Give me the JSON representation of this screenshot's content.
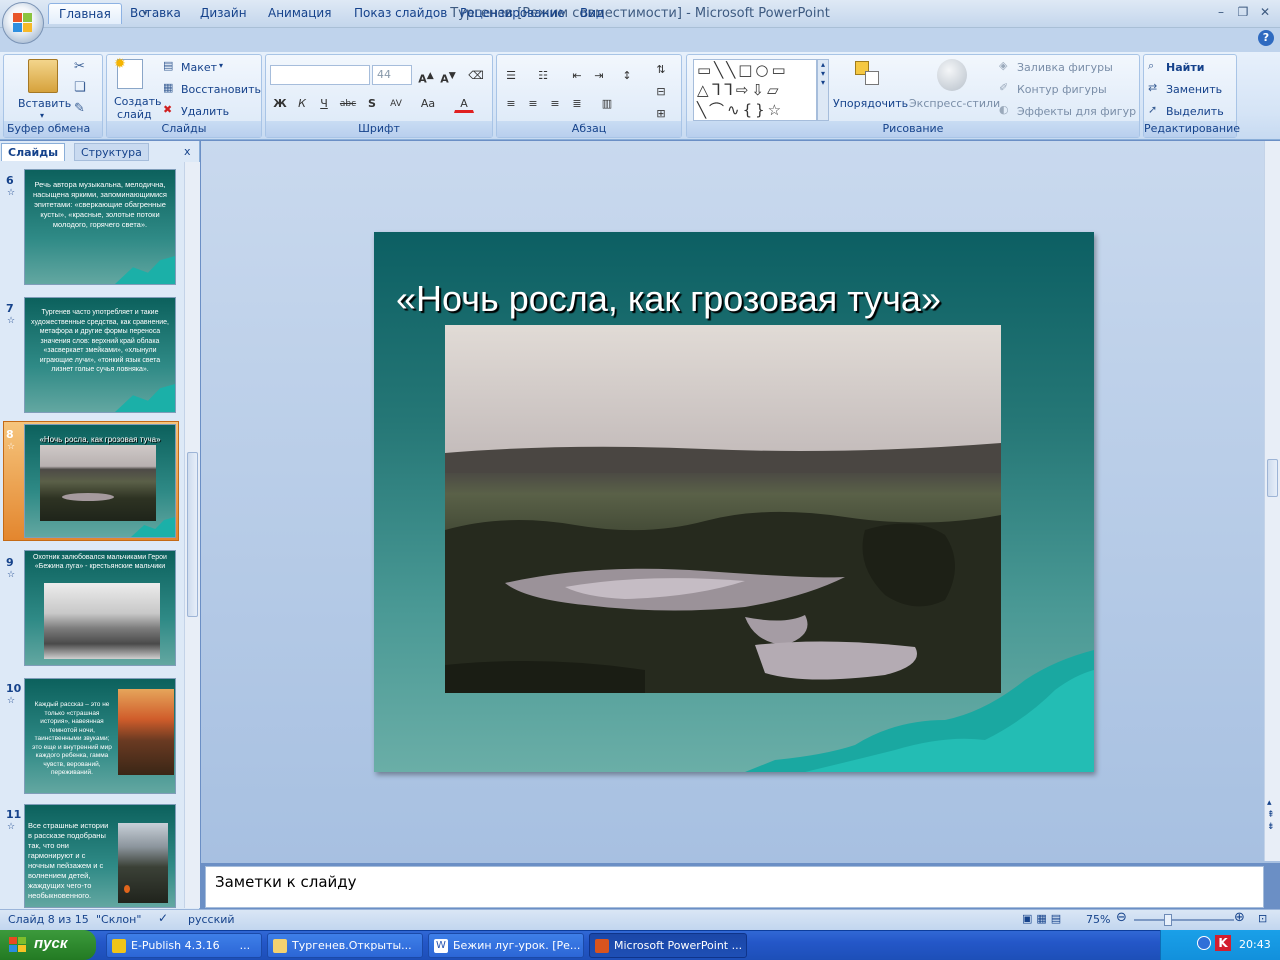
{
  "window": {
    "title": "Тургенев [Режим совместимости] - Microsoft PowerPoint"
  },
  "ribbon": {
    "tabs": [
      "Главная",
      "Вставка",
      "Дизайн",
      "Анимация",
      "Показ слайдов",
      "Рецензирование",
      "Вид"
    ],
    "clipboard": {
      "paste": "Вставить",
      "label": "Буфер обмена"
    },
    "slides": {
      "new_slide_1": "Создать",
      "new_slide_2": "слайд",
      "layout": "Макет",
      "reset": "Восстановить",
      "delete": "Удалить",
      "label": "Слайды"
    },
    "font": {
      "size": "44",
      "label": "Шрифт"
    },
    "paragraph": {
      "label": "Абзац"
    },
    "drawing": {
      "arrange": "Упорядочить",
      "quick_styles": "Экспресс-стили",
      "fill": "Заливка фигуры",
      "outline": "Контур фигуры",
      "effects": "Эффекты для фигур",
      "label": "Рисование"
    },
    "editing": {
      "find": "Найти",
      "replace": "Заменить",
      "select": "Выделить",
      "label": "Редактирование"
    }
  },
  "panel": {
    "tabs": [
      "Слайды",
      "Структура"
    ],
    "close": "x",
    "thumbnails": [
      {
        "num": "6",
        "text": "Речь автора музыкальна, мелодична, насыщена яркими, запоминающимися эпитетами: «сверкающие обагренные кусты», «красные, золотые потоки молодого, горячего света»."
      },
      {
        "num": "7",
        "text": "Тургенев часто употребляет и такие художественные средства, как сравнение, метафора и другие формы переноса значения слов: верхний край облака «засверкает змейками», «хлынули играющие лучи», «тонкий язык света лизнет голые сучья ловняка»."
      },
      {
        "num": "8",
        "text": "«Ночь росла, как грозовая туча»"
      },
      {
        "num": "9",
        "text": "Охотник залюбовался мальчиками Герои «Бежина луга» - крестьянские мальчики"
      },
      {
        "num": "10",
        "text": "Каждый рассказ – это не только «страшная история», навеянная темнотой ночи, таинственными звуками; это еще и внутренний мир каждого ребенка, гамма чувств, верований, переживаний."
      },
      {
        "num": "11",
        "text": "Все страшные истории в рассказе подобраны так, что они гармонируют и с ночным пейзажем и с волнением детей, жаждущих чего-то необыкновенного."
      }
    ]
  },
  "slide": {
    "title": "«Ночь росла, как грозовая туча»"
  },
  "notes": {
    "placeholder": "Заметки к слайду"
  },
  "status": {
    "slide_info": "Слайд 8 из 15",
    "theme": "\"Склон\"",
    "language": "русский",
    "zoom": "75%"
  },
  "taskbar": {
    "start": "пуск",
    "items": [
      "E-Publish 4.3.16",
      "...",
      "Тургенев.Открыты...",
      "Бежин луг-урок. [Ре...",
      "Microsoft PowerPoint ..."
    ],
    "lang": "RU",
    "time": "20:43"
  }
}
